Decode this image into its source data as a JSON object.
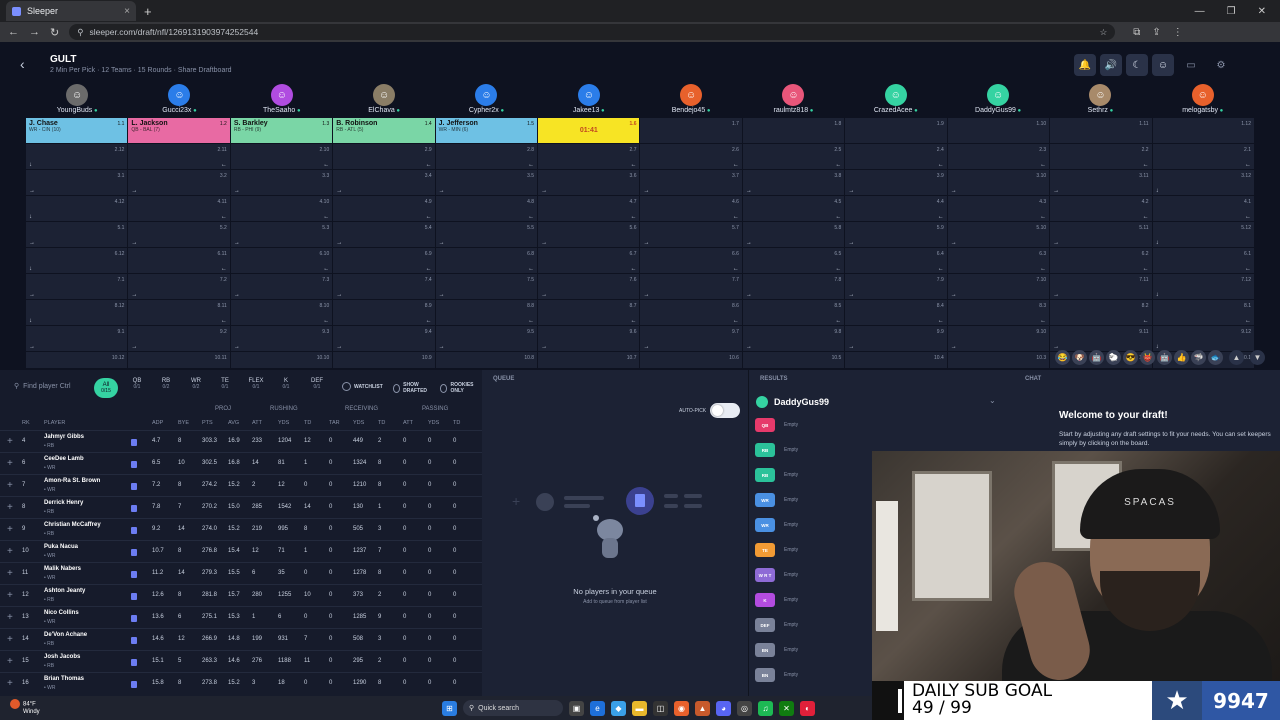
{
  "browser": {
    "tab_title": "Sleeper",
    "url": "sleeper.com/draft/nfl/1269131903974252544"
  },
  "draft": {
    "league": "GULT",
    "subtitle": "2 Min Per Pick · 12 Teams · 15 Rounds · Share Draftboard"
  },
  "teams": [
    {
      "name": "YoungBuds",
      "color": "#6b6b6b"
    },
    {
      "name": "Gucci23x",
      "color": "#2b7de9"
    },
    {
      "name": "TheSaaho",
      "color": "#b04ce0"
    },
    {
      "name": "ElChava",
      "color": "#8a7d66"
    },
    {
      "name": "Cypher2x",
      "color": "#2b7de9"
    },
    {
      "name": "Jakee13",
      "color": "#2b7de9"
    },
    {
      "name": "Bendejo45",
      "color": "#e8612c"
    },
    {
      "name": "raulmtz818",
      "color": "#e8567a"
    },
    {
      "name": "CrazedAcee",
      "color": "#35d3a2"
    },
    {
      "name": "DaddyGus99",
      "color": "#35d3a2"
    },
    {
      "name": "Sethrz",
      "color": "#a88a6a"
    },
    {
      "name": "melogatsby",
      "color": "#e8612c"
    }
  ],
  "round1": [
    {
      "player": "J. Chase",
      "pos": "WR - CIN (10)",
      "pick": "1.1",
      "color": "#6ec1e4"
    },
    {
      "player": "L. Jackson",
      "pos": "QB - BAL (7)",
      "pick": "1.2",
      "color": "#e86aa3"
    },
    {
      "player": "S. Barkley",
      "pos": "RB - PHI (9)",
      "pick": "1.3",
      "color": "#7ad6a6"
    },
    {
      "player": "B. Robinson",
      "pos": "RB - ATL (5)",
      "pick": "1.4",
      "color": "#7ad6a6"
    },
    {
      "player": "J. Jefferson",
      "pos": "WR - MIN (6)",
      "pick": "1.5",
      "color": "#6ec1e4"
    },
    {
      "player": "01:41",
      "pos": "",
      "pick": "1.6",
      "color": "#f7e424"
    },
    {
      "player": "",
      "pos": "",
      "pick": "1.7"
    },
    {
      "player": "",
      "pos": "",
      "pick": "1.8"
    },
    {
      "player": "",
      "pos": "",
      "pick": "1.9"
    },
    {
      "player": "",
      "pos": "",
      "pick": "1.10"
    },
    {
      "player": "",
      "pos": "",
      "pick": "1.11"
    },
    {
      "player": "",
      "pos": "",
      "pick": "1.12"
    }
  ],
  "search": {
    "placeholder": "Find player Ctrl"
  },
  "position_filters": [
    {
      "label": "All",
      "count": "0/15"
    },
    {
      "label": "QB",
      "count": "0/1"
    },
    {
      "label": "RB",
      "count": "0/2"
    },
    {
      "label": "WR",
      "count": "0/2"
    },
    {
      "label": "TE",
      "count": "0/1"
    },
    {
      "label": "FLEX",
      "count": "0/1"
    },
    {
      "label": "K",
      "count": "0/1"
    },
    {
      "label": "DEF",
      "count": "0/1"
    }
  ],
  "toggles": [
    "WATCHLIST",
    "SHOW DRAFTED",
    "ROOKIES ONLY"
  ],
  "column_groups": [
    "PROJ",
    "RUSHING",
    "RECEIVING",
    "PASSING"
  ],
  "columns": [
    "RK",
    "PLAYER",
    "ADP",
    "BYE",
    "PTS",
    "AVG",
    "ATT",
    "YDS",
    "TD",
    "TAR",
    "YDS",
    "TD",
    "ATT",
    "YDS",
    "TD"
  ],
  "players": [
    {
      "rk": "4",
      "name": "Jahmyr Gibbs",
      "pos": "• RB",
      "adp": "4.7",
      "bye": "8",
      "pts": "303.3",
      "avg": "16.9",
      "ratt": "233",
      "ryds": "1204",
      "rtd": "12",
      "tar": "0",
      "cyds": "449",
      "ctd": "2",
      "patt": "0",
      "pyds": "0",
      "ptd": "0"
    },
    {
      "rk": "6",
      "name": "CeeDee Lamb",
      "pos": "• WR",
      "adp": "6.5",
      "bye": "10",
      "pts": "302.5",
      "avg": "16.8",
      "ratt": "14",
      "ryds": "81",
      "rtd": "1",
      "tar": "0",
      "cyds": "1324",
      "ctd": "8",
      "patt": "0",
      "pyds": "0",
      "ptd": "0"
    },
    {
      "rk": "7",
      "name": "Amon-Ra St. Brown",
      "pos": "• WR",
      "adp": "7.2",
      "bye": "8",
      "pts": "274.2",
      "avg": "15.2",
      "ratt": "2",
      "ryds": "12",
      "rtd": "0",
      "tar": "0",
      "cyds": "1210",
      "ctd": "8",
      "patt": "0",
      "pyds": "0",
      "ptd": "0"
    },
    {
      "rk": "8",
      "name": "Derrick Henry",
      "pos": "• RB",
      "adp": "7.8",
      "bye": "7",
      "pts": "270.2",
      "avg": "15.0",
      "ratt": "285",
      "ryds": "1542",
      "rtd": "14",
      "tar": "0",
      "cyds": "130",
      "ctd": "1",
      "patt": "0",
      "pyds": "0",
      "ptd": "0"
    },
    {
      "rk": "9",
      "name": "Christian McCaffrey",
      "pos": "• RB",
      "adp": "9.2",
      "bye": "14",
      "pts": "274.0",
      "avg": "15.2",
      "ratt": "219",
      "ryds": "995",
      "rtd": "8",
      "tar": "0",
      "cyds": "505",
      "ctd": "3",
      "patt": "0",
      "pyds": "0",
      "ptd": "0"
    },
    {
      "rk": "10",
      "name": "Puka Nacua",
      "pos": "• WR",
      "adp": "10.7",
      "bye": "8",
      "pts": "276.8",
      "avg": "15.4",
      "ratt": "12",
      "ryds": "71",
      "rtd": "1",
      "tar": "0",
      "cyds": "1237",
      "ctd": "7",
      "patt": "0",
      "pyds": "0",
      "ptd": "0"
    },
    {
      "rk": "11",
      "name": "Malik Nabers",
      "pos": "• WR",
      "adp": "11.2",
      "bye": "14",
      "pts": "279.3",
      "avg": "15.5",
      "ratt": "6",
      "ryds": "35",
      "rtd": "0",
      "tar": "0",
      "cyds": "1278",
      "ctd": "8",
      "patt": "0",
      "pyds": "0",
      "ptd": "0"
    },
    {
      "rk": "12",
      "name": "Ashton Jeanty",
      "pos": "• RB",
      "adp": "12.6",
      "bye": "8",
      "pts": "281.8",
      "avg": "15.7",
      "ratt": "280",
      "ryds": "1255",
      "rtd": "10",
      "tar": "0",
      "cyds": "373",
      "ctd": "2",
      "patt": "0",
      "pyds": "0",
      "ptd": "0"
    },
    {
      "rk": "13",
      "name": "Nico Collins",
      "pos": "• WR",
      "adp": "13.6",
      "bye": "6",
      "pts": "275.1",
      "avg": "15.3",
      "ratt": "1",
      "ryds": "6",
      "rtd": "0",
      "tar": "0",
      "cyds": "1285",
      "ctd": "9",
      "patt": "0",
      "pyds": "0",
      "ptd": "0"
    },
    {
      "rk": "14",
      "name": "De'Von Achane",
      "pos": "• RB",
      "adp": "14.6",
      "bye": "12",
      "pts": "266.9",
      "avg": "14.8",
      "ratt": "199",
      "ryds": "931",
      "rtd": "7",
      "tar": "0",
      "cyds": "508",
      "ctd": "3",
      "patt": "0",
      "pyds": "0",
      "ptd": "0"
    },
    {
      "rk": "15",
      "name": "Josh Jacobs",
      "pos": "• RB",
      "adp": "15.1",
      "bye": "5",
      "pts": "263.3",
      "avg": "14.6",
      "ratt": "276",
      "ryds": "1188",
      "rtd": "11",
      "tar": "0",
      "cyds": "295",
      "ctd": "2",
      "patt": "0",
      "pyds": "0",
      "ptd": "0"
    },
    {
      "rk": "16",
      "name": "Brian Thomas",
      "pos": "• WR",
      "adp": "15.8",
      "bye": "8",
      "pts": "273.8",
      "avg": "15.2",
      "ratt": "3",
      "ryds": "18",
      "rtd": "0",
      "tar": "0",
      "cyds": "1290",
      "ctd": "8",
      "patt": "0",
      "pyds": "0",
      "ptd": "0"
    }
  ],
  "queue": {
    "title": "QUEUE",
    "autopick": "AUTO-PICK",
    "empty_title": "No players in your queue",
    "empty_sub": "Add to queue from player list"
  },
  "results": {
    "title": "RESULTS",
    "user": "DaddyGus99",
    "slots": [
      {
        "pos": "QB",
        "color": "#e63a6b",
        "value": "Empty"
      },
      {
        "pos": "RB",
        "color": "#2bc29a",
        "value": "Empty"
      },
      {
        "pos": "RB",
        "color": "#2bc29a",
        "value": "Empty"
      },
      {
        "pos": "WR",
        "color": "#4a90e2",
        "value": "Empty"
      },
      {
        "pos": "WR",
        "color": "#4a90e2",
        "value": "Empty"
      },
      {
        "pos": "TE",
        "color": "#f29b34",
        "value": "Empty"
      },
      {
        "pos": "W R T",
        "color": "#8e6bd6",
        "value": "Empty"
      },
      {
        "pos": "K",
        "color": "#b34ce0",
        "value": "Empty"
      },
      {
        "pos": "DEF",
        "color": "#7a8299",
        "value": "Empty"
      },
      {
        "pos": "BN",
        "color": "#7a8299",
        "value": "Empty"
      },
      {
        "pos": "BN",
        "color": "#7a8299",
        "value": "Empty"
      }
    ]
  },
  "chat": {
    "title": "CHAT",
    "welcome": "Welcome to your draft!",
    "desc": "Start by adjusting any draft settings to fit your needs. You can set keepers simply by clicking on the board."
  },
  "stream": {
    "goal_line1": "DAILY SUB GOAL",
    "goal_line2": "49 / 99",
    "goal_count": "9947",
    "beanie_text": "SPACAS"
  },
  "taskbar": {
    "temp": "84°F",
    "condition": "Windy",
    "search": "Quick search"
  },
  "rows": [
    [
      "2.12",
      "2.11",
      "2.10",
      "2.9",
      "2.8",
      "2.7",
      "2.6",
      "2.5",
      "2.4",
      "2.3",
      "2.2",
      "2.1"
    ],
    [
      "3.1",
      "3.2",
      "3.3",
      "3.4",
      "3.5",
      "3.6",
      "3.7",
      "3.8",
      "3.9",
      "3.10",
      "3.11",
      "3.12"
    ],
    [
      "4.12",
      "4.11",
      "4.10",
      "4.9",
      "4.8",
      "4.7",
      "4.6",
      "4.5",
      "4.4",
      "4.3",
      "4.2",
      "4.1"
    ],
    [
      "5.1",
      "5.2",
      "5.3",
      "5.4",
      "5.5",
      "5.6",
      "5.7",
      "5.8",
      "5.9",
      "5.10",
      "5.11",
      "5.12"
    ],
    [
      "6.12",
      "6.11",
      "6.10",
      "6.9",
      "6.8",
      "6.7",
      "6.6",
      "6.5",
      "6.4",
      "6.3",
      "6.2",
      "6.1"
    ],
    [
      "7.1",
      "7.2",
      "7.3",
      "7.4",
      "7.5",
      "7.6",
      "7.7",
      "7.8",
      "7.9",
      "7.10",
      "7.11",
      "7.12"
    ],
    [
      "8.12",
      "8.11",
      "8.10",
      "8.9",
      "8.8",
      "8.7",
      "8.6",
      "8.5",
      "8.4",
      "8.3",
      "8.2",
      "8.1"
    ],
    [
      "9.1",
      "9.2",
      "9.3",
      "9.4",
      "9.5",
      "9.6",
      "9.7",
      "9.8",
      "9.9",
      "9.10",
      "9.11",
      "9.12"
    ],
    [
      "10.12",
      "10.11",
      "10.10",
      "10.9",
      "10.8",
      "10.7",
      "10.6",
      "10.5",
      "10.4",
      "10.3",
      "10.2",
      "10.1"
    ]
  ]
}
